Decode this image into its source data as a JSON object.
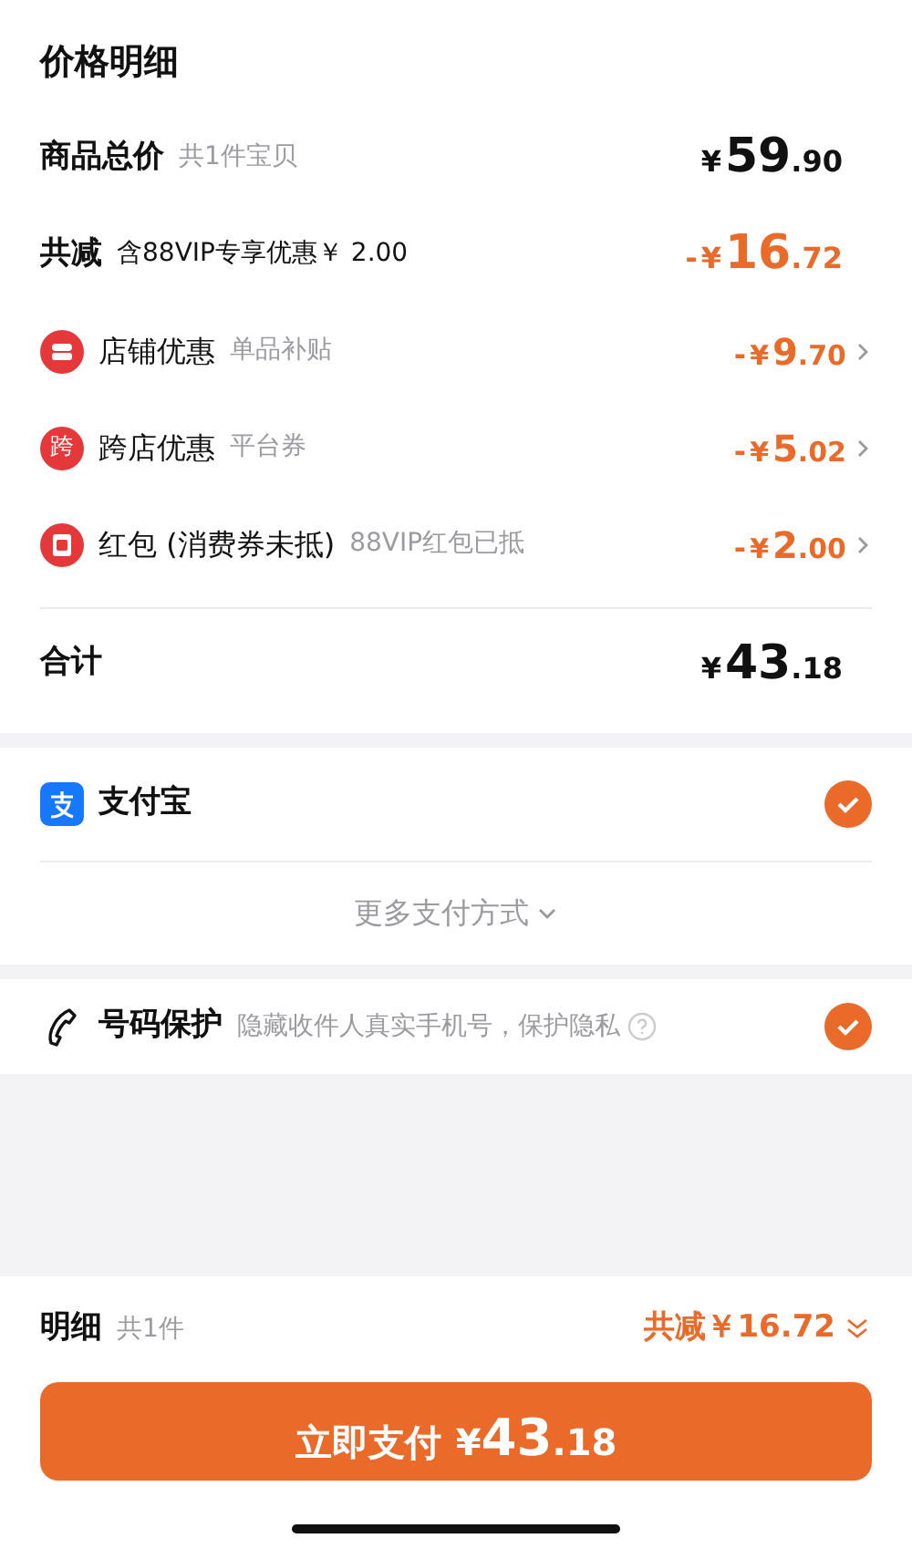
{
  "title": "价格明细",
  "summary_rows": [
    {
      "label": "商品总价",
      "note": "共1件宝贝",
      "sign": "",
      "currency": "¥",
      "amount": "59.90",
      "discount": false
    },
    {
      "label": "共减",
      "note": "含88VIP专享优惠￥ 2.00",
      "sign": "-",
      "currency": "¥",
      "amount": "16.72",
      "discount": true
    }
  ],
  "discounts": [
    {
      "kind": "shop",
      "label": "店铺优惠",
      "note": "单品补贴",
      "sign": "-",
      "currency": "¥",
      "amount": "9.70"
    },
    {
      "kind": "cross",
      "icon_text": "跨",
      "label": "跨店优惠",
      "note": "平台券",
      "sign": "-",
      "currency": "¥",
      "amount": "5.02"
    },
    {
      "kind": "redpacket",
      "label": "红包 (消费券未抵)",
      "note": "88VIP红包已抵",
      "sign": "-",
      "currency": "¥",
      "amount": "2.00"
    }
  ],
  "total": {
    "label": "合计",
    "currency": "¥",
    "amount": "43.18"
  },
  "payment": {
    "methods": [
      {
        "label": "支付宝",
        "selected": true
      }
    ],
    "more": "更多支付方式"
  },
  "phone_protection": {
    "label": "号码保护",
    "note": "隐藏收件人真实手机号，保护隐私",
    "checked": true
  },
  "footer": {
    "label": "明细",
    "count": "共1件",
    "saving": "共减￥16.72",
    "pay_label": "立即支付",
    "currency": "¥",
    "amount": "43.18"
  }
}
